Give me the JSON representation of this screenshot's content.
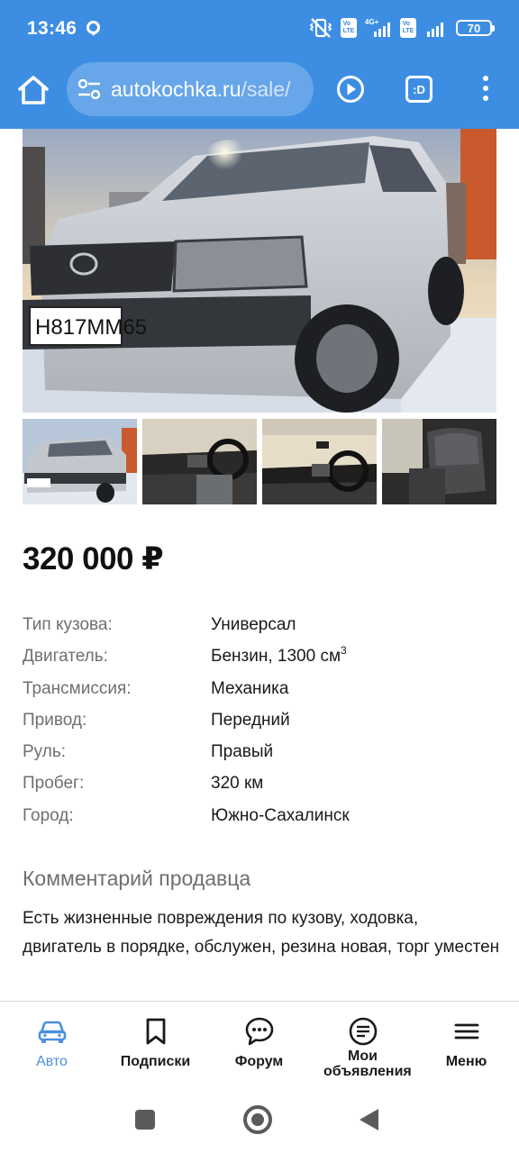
{
  "status_bar": {
    "time": "13:46",
    "battery": "70",
    "network_label": "4G+",
    "volte_label": "Vo LTE"
  },
  "browser": {
    "url_domain": "autokochka.ru",
    "url_path": "/sale/",
    "extension_badge": ":D"
  },
  "listing": {
    "price": "320 000 ₽",
    "plate_text": "Н817ММ65",
    "specs": [
      {
        "label": "Тип кузова:",
        "value": "Универсал"
      },
      {
        "label": "Двигатель:",
        "value": "Бензин, 1300 см",
        "sup": "3"
      },
      {
        "label": "Трансмиссия:",
        "value": "Механика"
      },
      {
        "label": "Привод:",
        "value": "Передний"
      },
      {
        "label": "Руль:",
        "value": "Правый"
      },
      {
        "label": "Пробег:",
        "value": "320 км"
      },
      {
        "label": "Город:",
        "value": "Южно-Сахалинск"
      }
    ],
    "comment_title": "Комментарий продавца",
    "comment_text": "Есть жизненные повреждения по кузову, ходовка, двигатель в порядке, обслужен, резина новая, торг уместен"
  },
  "bottom_nav": {
    "items": [
      {
        "label": "Авто",
        "icon": "car-icon",
        "active": true
      },
      {
        "label": "Подписки",
        "icon": "bookmark-icon",
        "active": false
      },
      {
        "label": "Форум",
        "icon": "chat-bubble-icon",
        "active": false
      },
      {
        "label": "Мои объявления",
        "icon": "document-list-icon",
        "active": false
      },
      {
        "label": "Меню",
        "icon": "hamburger-menu-icon",
        "active": false
      }
    ]
  },
  "colors": {
    "chrome": "#3d8ee3",
    "active_nav": "#4a8fe0",
    "label_gray": "#6f6f6f",
    "car_body": "#c9ccd2"
  }
}
